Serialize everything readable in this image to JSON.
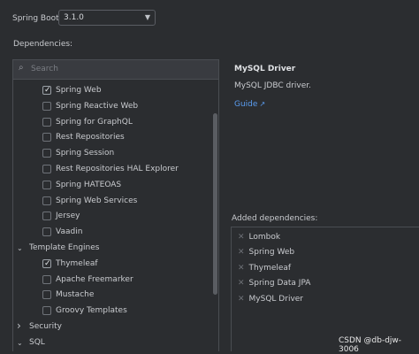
{
  "spring_boot": {
    "label": "Spring Boot:",
    "version": "3.1.0"
  },
  "dependencies_label": "Dependencies:",
  "search": {
    "placeholder": "Search"
  },
  "tree": [
    {
      "type": "item",
      "label": "Spring Web",
      "checked": true
    },
    {
      "type": "item",
      "label": "Spring Reactive Web",
      "checked": false
    },
    {
      "type": "item",
      "label": "Spring for GraphQL",
      "checked": false
    },
    {
      "type": "item",
      "label": "Rest Repositories",
      "checked": false
    },
    {
      "type": "item",
      "label": "Spring Session",
      "checked": false
    },
    {
      "type": "item",
      "label": "Rest Repositories HAL Explorer",
      "checked": false
    },
    {
      "type": "item",
      "label": "Spring HATEOAS",
      "checked": false
    },
    {
      "type": "item",
      "label": "Spring Web Services",
      "checked": false
    },
    {
      "type": "item",
      "label": "Jersey",
      "checked": false
    },
    {
      "type": "item",
      "label": "Vaadin",
      "checked": false
    },
    {
      "type": "category",
      "label": "Template Engines",
      "expanded": true
    },
    {
      "type": "item",
      "label": "Thymeleaf",
      "checked": true
    },
    {
      "type": "item",
      "label": "Apache Freemarker",
      "checked": false
    },
    {
      "type": "item",
      "label": "Mustache",
      "checked": false
    },
    {
      "type": "item",
      "label": "Groovy Templates",
      "checked": false
    },
    {
      "type": "category",
      "label": "Security",
      "expanded": false
    },
    {
      "type": "category",
      "label": "SQL",
      "expanded": true
    }
  ],
  "detail": {
    "title": "MySQL Driver",
    "description": "MySQL JDBC driver.",
    "guide_label": "Guide",
    "guide_icon": "external-link-icon"
  },
  "added": {
    "label": "Added dependencies:",
    "items": [
      "Lombok",
      "Spring Web",
      "Thymeleaf",
      "Spring Data JPA",
      "MySQL Driver"
    ]
  },
  "watermark": "CSDN @db-djw-3006",
  "colors": {
    "background": "#2b2d30",
    "link": "#5a9cf0",
    "border": "#4a4d52"
  }
}
